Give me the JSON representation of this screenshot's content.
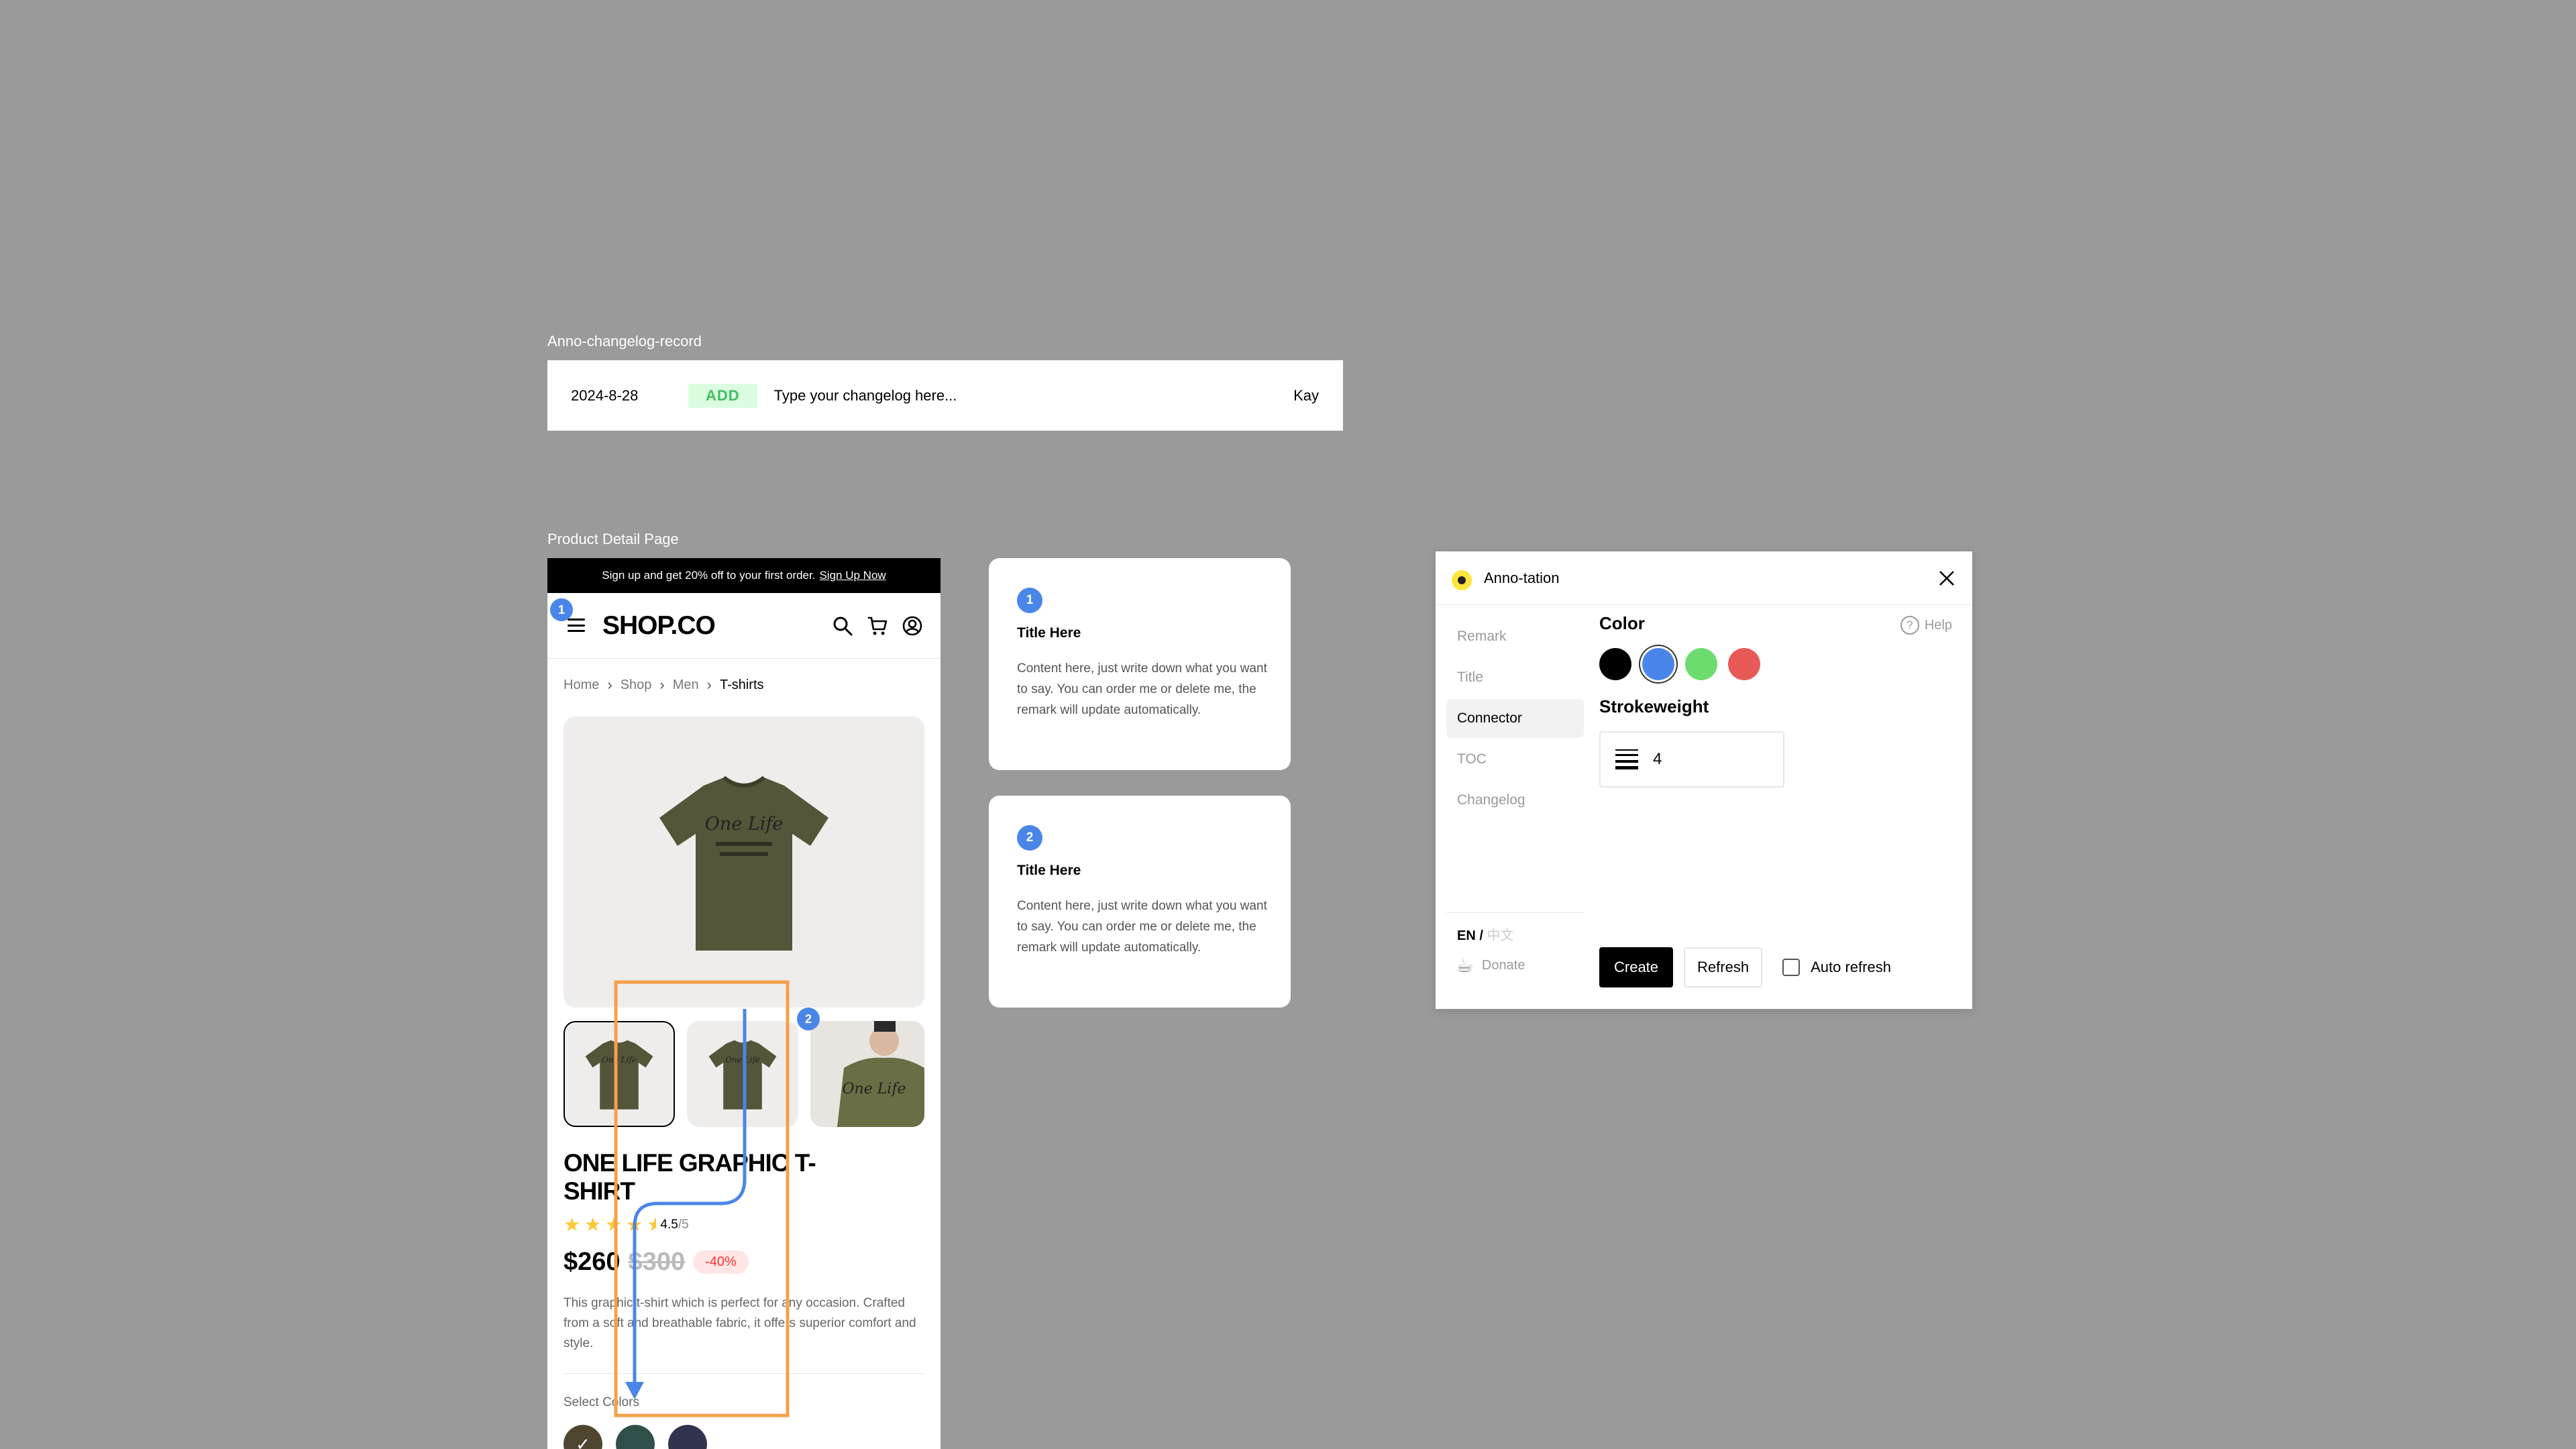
{
  "frames": {
    "changelog_label": "Anno-changelog-record",
    "product_label": "Product Detail Page"
  },
  "changelog": {
    "date": "2024-8-28",
    "tag": "ADD",
    "text": "Type your changelog here...",
    "author": "Kay",
    "tag_color": "#3fbf5f"
  },
  "product_page": {
    "promo": "Sign up and get 20% off to your first order.",
    "promo_link": "Sign Up Now",
    "logo": "SHOP.CO",
    "breadcrumb": [
      "Home",
      "Shop",
      "Men",
      "T-shirts"
    ],
    "title": "ONE LIFE GRAPHIC T-SHIRT",
    "rating": 4.5,
    "rating_text": "4.5",
    "rating_max": "/5",
    "price": "$260",
    "old_price": "$300",
    "discount": "-40%",
    "description": "This graphic t-shirt which is perfect for any occasion. Crafted from a soft and breathable fabric, it offers superior comfort and style.",
    "select_colors_label": "Select Colors",
    "swatch_colors": [
      "#4f4631",
      "#314f4a",
      "#31344f"
    ],
    "shirt_color": "#5a5a3c"
  },
  "annotation_badges": [
    "1",
    "2"
  ],
  "remarks": [
    {
      "number": "1",
      "title": "Title Here",
      "content": "Content here, just write down what you want to say. You can order me or delete me, the remark will update automatically."
    },
    {
      "number": "2",
      "title": "Title Here",
      "content": "Content here, just write down what you want to say. You can order me or delete me, the remark will update automatically."
    }
  ],
  "panel": {
    "title": "Anno-tation",
    "nav": [
      "Remark",
      "Title",
      "Connector",
      "TOC",
      "Changelog"
    ],
    "active_nav": "Connector",
    "help": "Help",
    "color_label": "Color",
    "colors": [
      "#000000",
      "#4a86e8",
      "#6ddc6e",
      "#e85a55"
    ],
    "selected_color": "#4a86e8",
    "strokeweight_label": "Strokeweight",
    "strokeweight_value": "4",
    "lang_active": "EN",
    "lang_sep": " / ",
    "lang_inactive": "中文",
    "donate": "Donate",
    "create": "Create",
    "refresh": "Refresh",
    "auto_refresh": "Auto refresh"
  },
  "accent_colors": {
    "connector": "#4a86e8",
    "highlight_box": "#f5a04b"
  }
}
